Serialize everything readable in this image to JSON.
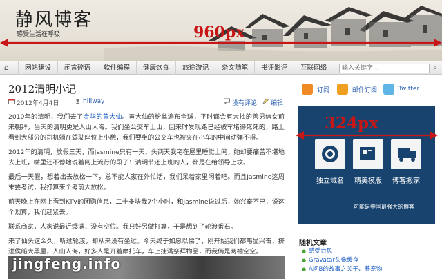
{
  "header": {
    "title": "静风博客",
    "subtitle": "感受生活在呼吸",
    "width_annotation": "960px"
  },
  "nav": {
    "items": [
      "网站建设",
      "闲言碎语",
      "软件编程",
      "健康饮食",
      "旅途游记",
      "杂文随笔",
      "书评影评",
      "互联网络"
    ],
    "search_placeholder": "输入关键字..."
  },
  "post": {
    "title": "2012清明小记",
    "date": "2012年4月4日",
    "author": "hillway",
    "comments": "没有评论",
    "edit": "编辑",
    "p1_a": "2010年的清明，我们去了",
    "p1_link": "金华的黄大仙",
    "p1_b": "。黄大仙的粉丝遍布全球，平时都会有大批的善男信女前来朝拜，当天的清明更是人山人海。我们坐公交车上山，回来时发现路已经被车堵得死死的，路上看到大部分的司机躺在驾驶座位上小憩，我们要坐的公交车也被夹在小车的中间动弹不得。",
    "p2": "2012年的清明，放假三天，而Jasmine只有一天，头两天我宅在屋里睡觉上网，她却要痛苦不堪地去上班，嘴里还不停地说着网上流行的段子：清明节还上班的人，都是在给领导上坟。",
    "p3": "最后一天假，想着出去放松一下，总不能人家在外忙活，我们呆着家里闲着吧。而且Jasmine这周末要考试，我打算来个考前大放松。",
    "p4": "前天晚上在网上看到KTV的团购信息，二十多块我7个小时，和Jasmine说过后，她兴奋不已，说这个划算，我们赶紧去。",
    "p5": "联系商家，人家说最近爆满，没有空位。我只好另做打算，于是想到了轮渡番石。",
    "p6": "来了仙头这么久，听过轮渡，却从来没有坐过。今天终于如愿以偿了，刚开始我们都略显兴奋，挤进侯船大黑屋，人山人海，好多人是开着摩托车，车上挂满祭拜物品，而我俩是两袖空空。",
    "watermark": "jingfeng.info"
  },
  "sidebar": {
    "social": [
      "订阅",
      "邮件订阅",
      "Twitter"
    ],
    "width_annotation": "324px",
    "ad": {
      "labels": [
        "独立域名",
        "精美模版",
        "博客搬家"
      ],
      "footer": "可能是中国最强大的博客"
    },
    "widget": {
      "title": "随机文章",
      "items": [
        "感受台风",
        "Gravatar头像缓存",
        "A问B的故事之关于、养宠物"
      ]
    }
  },
  "colors": {
    "annotation_red": "#c81616",
    "ad_bg": "#18436e",
    "link_blue": "#1d5fc5",
    "bullet_green": "#4ba432"
  }
}
